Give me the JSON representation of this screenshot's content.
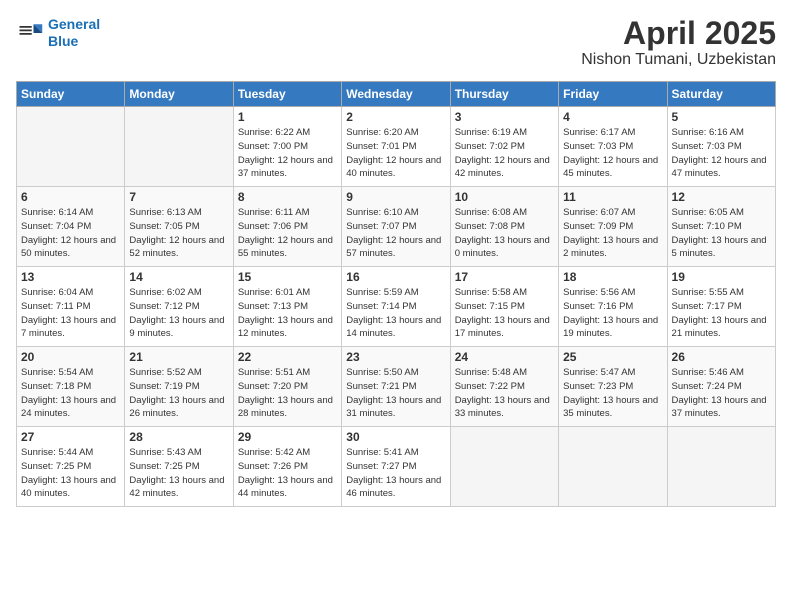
{
  "logo": {
    "line1": "General",
    "line2": "Blue"
  },
  "title": "April 2025",
  "location": "Nishon Tumani, Uzbekistan",
  "weekdays": [
    "Sunday",
    "Monday",
    "Tuesday",
    "Wednesday",
    "Thursday",
    "Friday",
    "Saturday"
  ],
  "weeks": [
    [
      {
        "day": "",
        "info": ""
      },
      {
        "day": "",
        "info": ""
      },
      {
        "day": "1",
        "info": "Sunrise: 6:22 AM\nSunset: 7:00 PM\nDaylight: 12 hours and 37 minutes."
      },
      {
        "day": "2",
        "info": "Sunrise: 6:20 AM\nSunset: 7:01 PM\nDaylight: 12 hours and 40 minutes."
      },
      {
        "day": "3",
        "info": "Sunrise: 6:19 AM\nSunset: 7:02 PM\nDaylight: 12 hours and 42 minutes."
      },
      {
        "day": "4",
        "info": "Sunrise: 6:17 AM\nSunset: 7:03 PM\nDaylight: 12 hours and 45 minutes."
      },
      {
        "day": "5",
        "info": "Sunrise: 6:16 AM\nSunset: 7:03 PM\nDaylight: 12 hours and 47 minutes."
      }
    ],
    [
      {
        "day": "6",
        "info": "Sunrise: 6:14 AM\nSunset: 7:04 PM\nDaylight: 12 hours and 50 minutes."
      },
      {
        "day": "7",
        "info": "Sunrise: 6:13 AM\nSunset: 7:05 PM\nDaylight: 12 hours and 52 minutes."
      },
      {
        "day": "8",
        "info": "Sunrise: 6:11 AM\nSunset: 7:06 PM\nDaylight: 12 hours and 55 minutes."
      },
      {
        "day": "9",
        "info": "Sunrise: 6:10 AM\nSunset: 7:07 PM\nDaylight: 12 hours and 57 minutes."
      },
      {
        "day": "10",
        "info": "Sunrise: 6:08 AM\nSunset: 7:08 PM\nDaylight: 13 hours and 0 minutes."
      },
      {
        "day": "11",
        "info": "Sunrise: 6:07 AM\nSunset: 7:09 PM\nDaylight: 13 hours and 2 minutes."
      },
      {
        "day": "12",
        "info": "Sunrise: 6:05 AM\nSunset: 7:10 PM\nDaylight: 13 hours and 5 minutes."
      }
    ],
    [
      {
        "day": "13",
        "info": "Sunrise: 6:04 AM\nSunset: 7:11 PM\nDaylight: 13 hours and 7 minutes."
      },
      {
        "day": "14",
        "info": "Sunrise: 6:02 AM\nSunset: 7:12 PM\nDaylight: 13 hours and 9 minutes."
      },
      {
        "day": "15",
        "info": "Sunrise: 6:01 AM\nSunset: 7:13 PM\nDaylight: 13 hours and 12 minutes."
      },
      {
        "day": "16",
        "info": "Sunrise: 5:59 AM\nSunset: 7:14 PM\nDaylight: 13 hours and 14 minutes."
      },
      {
        "day": "17",
        "info": "Sunrise: 5:58 AM\nSunset: 7:15 PM\nDaylight: 13 hours and 17 minutes."
      },
      {
        "day": "18",
        "info": "Sunrise: 5:56 AM\nSunset: 7:16 PM\nDaylight: 13 hours and 19 minutes."
      },
      {
        "day": "19",
        "info": "Sunrise: 5:55 AM\nSunset: 7:17 PM\nDaylight: 13 hours and 21 minutes."
      }
    ],
    [
      {
        "day": "20",
        "info": "Sunrise: 5:54 AM\nSunset: 7:18 PM\nDaylight: 13 hours and 24 minutes."
      },
      {
        "day": "21",
        "info": "Sunrise: 5:52 AM\nSunset: 7:19 PM\nDaylight: 13 hours and 26 minutes."
      },
      {
        "day": "22",
        "info": "Sunrise: 5:51 AM\nSunset: 7:20 PM\nDaylight: 13 hours and 28 minutes."
      },
      {
        "day": "23",
        "info": "Sunrise: 5:50 AM\nSunset: 7:21 PM\nDaylight: 13 hours and 31 minutes."
      },
      {
        "day": "24",
        "info": "Sunrise: 5:48 AM\nSunset: 7:22 PM\nDaylight: 13 hours and 33 minutes."
      },
      {
        "day": "25",
        "info": "Sunrise: 5:47 AM\nSunset: 7:23 PM\nDaylight: 13 hours and 35 minutes."
      },
      {
        "day": "26",
        "info": "Sunrise: 5:46 AM\nSunset: 7:24 PM\nDaylight: 13 hours and 37 minutes."
      }
    ],
    [
      {
        "day": "27",
        "info": "Sunrise: 5:44 AM\nSunset: 7:25 PM\nDaylight: 13 hours and 40 minutes."
      },
      {
        "day": "28",
        "info": "Sunrise: 5:43 AM\nSunset: 7:25 PM\nDaylight: 13 hours and 42 minutes."
      },
      {
        "day": "29",
        "info": "Sunrise: 5:42 AM\nSunset: 7:26 PM\nDaylight: 13 hours and 44 minutes."
      },
      {
        "day": "30",
        "info": "Sunrise: 5:41 AM\nSunset: 7:27 PM\nDaylight: 13 hours and 46 minutes."
      },
      {
        "day": "",
        "info": ""
      },
      {
        "day": "",
        "info": ""
      },
      {
        "day": "",
        "info": ""
      }
    ]
  ]
}
